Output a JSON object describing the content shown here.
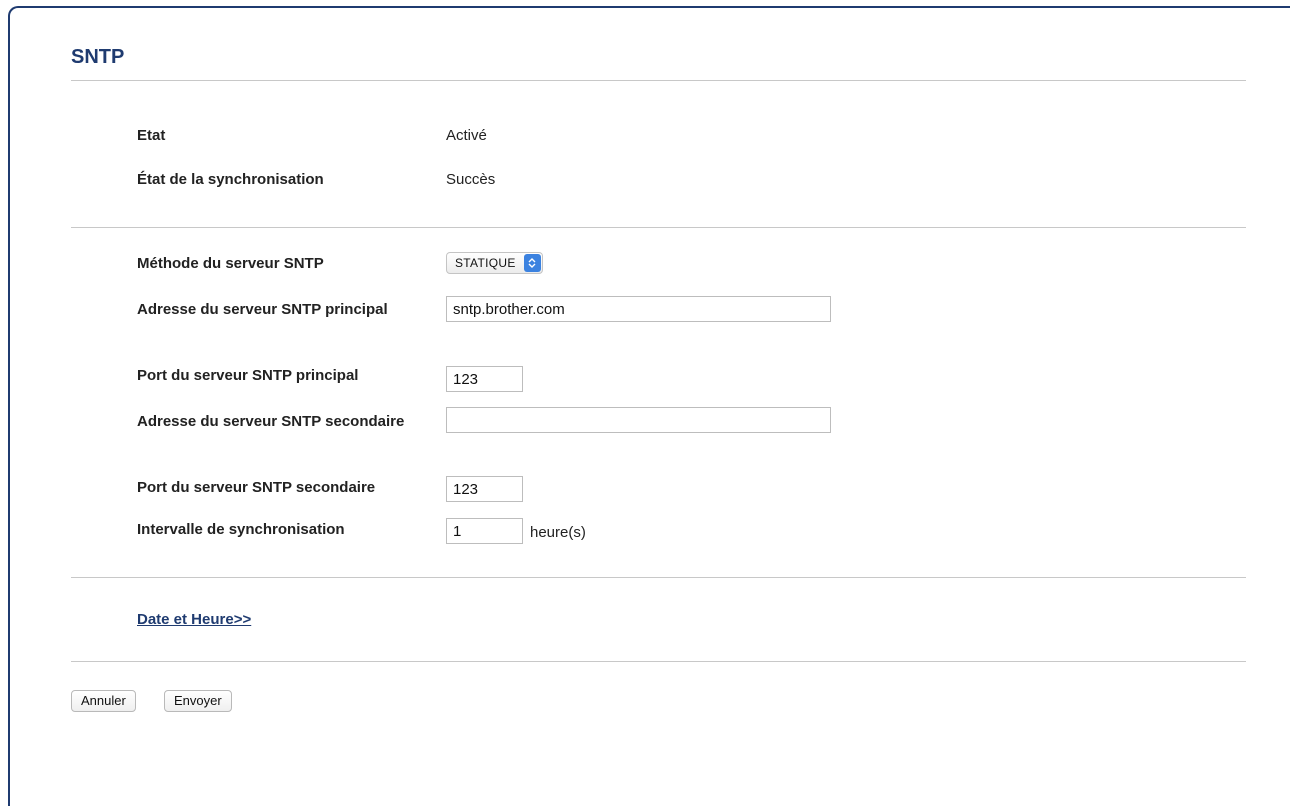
{
  "page": {
    "title": "SNTP"
  },
  "status": {
    "state_label": "Etat",
    "state_value": "Activé",
    "sync_label": "État de la synchronisation",
    "sync_value": "Succès"
  },
  "form": {
    "method_label": "Méthode du serveur SNTP",
    "method_value": "STATIQUE",
    "primary_address_label": "Adresse du serveur SNTP principal",
    "primary_address_value": "sntp.brother.com",
    "primary_port_label": "Port du serveur SNTP principal",
    "primary_port_value": "123",
    "secondary_address_label": "Adresse du serveur SNTP secondaire",
    "secondary_address_value": "",
    "secondary_port_label": "Port du serveur SNTP secondaire",
    "secondary_port_value": "123",
    "interval_label": "Intervalle de synchronisation",
    "interval_value": "1",
    "interval_unit": "heure(s)"
  },
  "links": {
    "date_time": "Date et Heure>>"
  },
  "buttons": {
    "cancel": "Annuler",
    "submit": "Envoyer"
  },
  "colors": {
    "title": "#1f3b70",
    "accent": "#3b82e0"
  },
  "icons": {
    "select_arrows": "chevron-up-down-icon"
  }
}
